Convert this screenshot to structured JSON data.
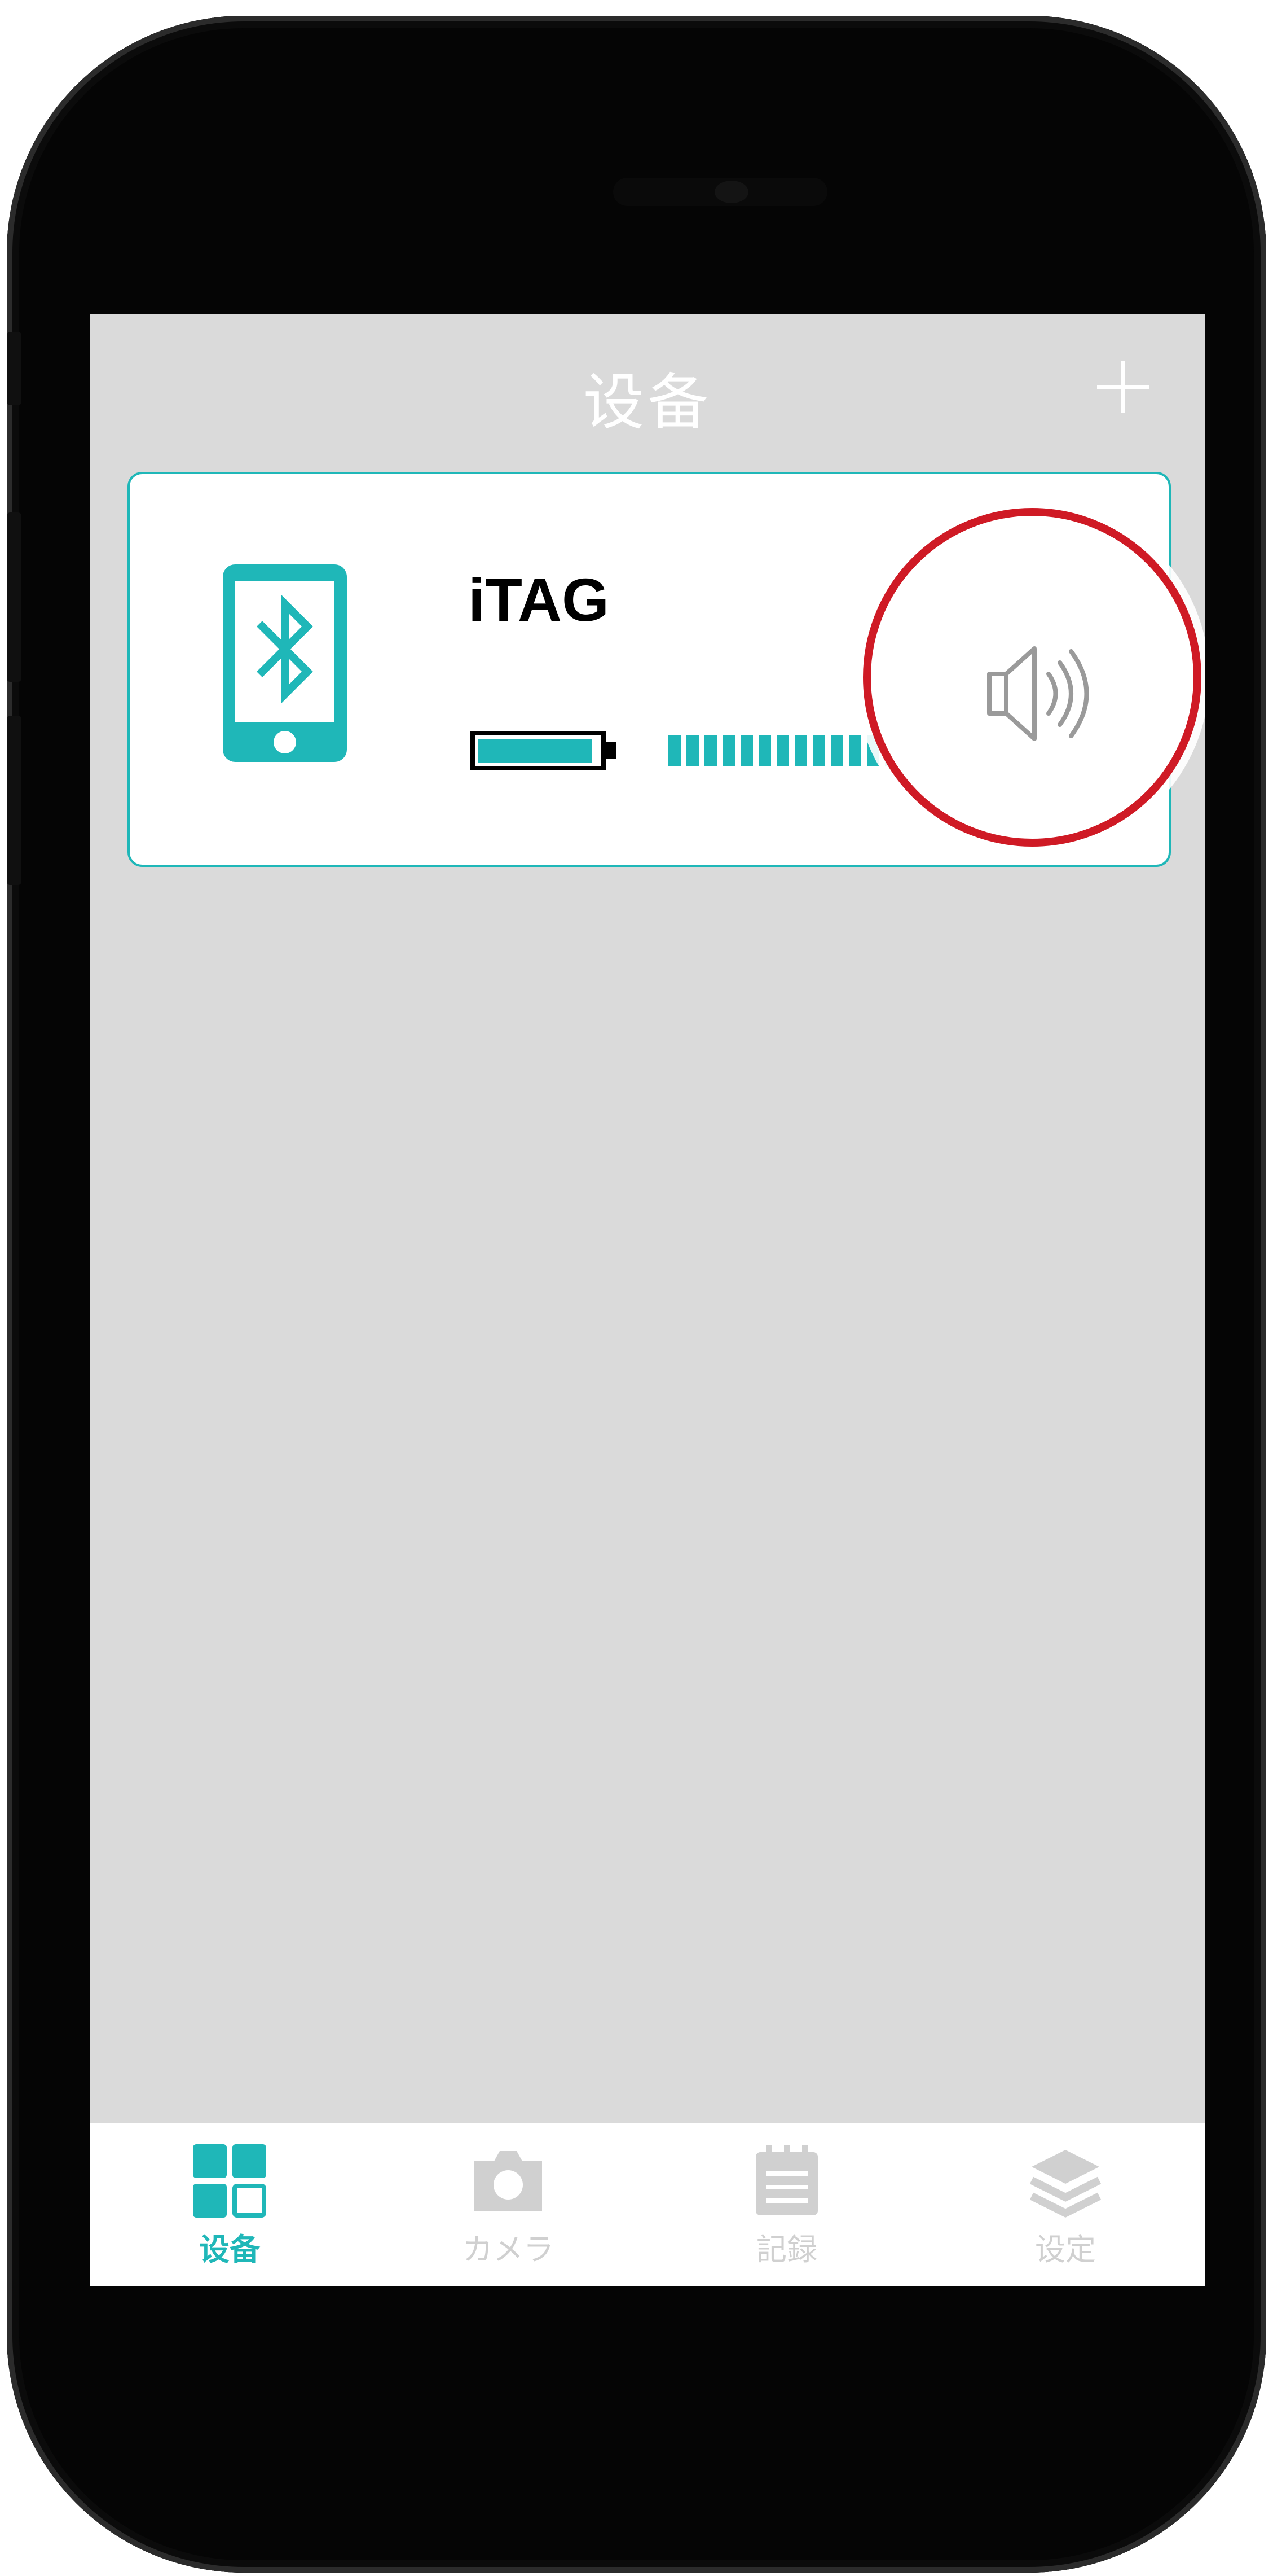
{
  "header": {
    "title": "设备"
  },
  "device": {
    "name": "iTAG",
    "battery_level": 0.95,
    "signal_bars_visible": 13
  },
  "tabs": [
    {
      "label": "设备",
      "icon": "grid-icon",
      "active": true
    },
    {
      "label": "カメラ",
      "icon": "camera-icon",
      "active": false
    },
    {
      "label": "記録",
      "icon": "notes-icon",
      "active": false
    },
    {
      "label": "设定",
      "icon": "layers-icon",
      "active": false
    }
  ],
  "colors": {
    "accent": "#1fb7b8",
    "highlight_ring": "#cf1a25",
    "background": "#dadada",
    "inactive": "#d0d0d0"
  }
}
